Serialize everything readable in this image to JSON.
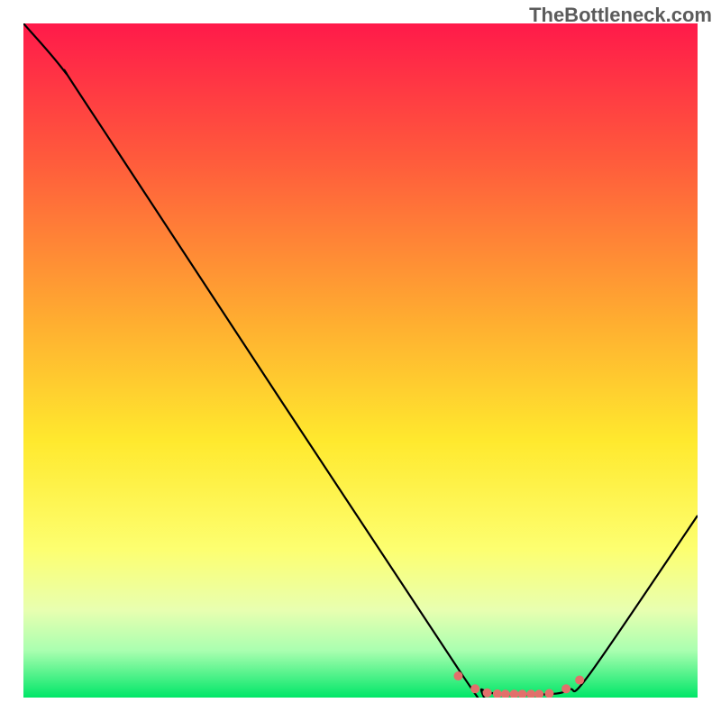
{
  "watermark": "TheBottleneck.com",
  "chart_data": {
    "type": "line",
    "title": "",
    "xlabel": "",
    "ylabel": "",
    "xlim": [
      0,
      100
    ],
    "ylim": [
      0,
      100
    ],
    "gradient_stops": [
      {
        "offset": 0,
        "color": "#ff1a4a"
      },
      {
        "offset": 20,
        "color": "#ff5a3c"
      },
      {
        "offset": 45,
        "color": "#ffb030"
      },
      {
        "offset": 62,
        "color": "#ffe92e"
      },
      {
        "offset": 78,
        "color": "#fdff70"
      },
      {
        "offset": 87,
        "color": "#e8ffb0"
      },
      {
        "offset": 93,
        "color": "#aaffb0"
      },
      {
        "offset": 100,
        "color": "#00e668"
      }
    ],
    "series": [
      {
        "name": "curve",
        "stroke": "#000000",
        "points": [
          {
            "x": 0,
            "y": 100
          },
          {
            "x": 6,
            "y": 93
          },
          {
            "x": 12,
            "y": 84
          },
          {
            "x": 65,
            "y": 3.5
          },
          {
            "x": 68,
            "y": 1.2
          },
          {
            "x": 71,
            "y": 0.5
          },
          {
            "x": 78,
            "y": 0.5
          },
          {
            "x": 81,
            "y": 1.2
          },
          {
            "x": 84,
            "y": 3.5
          },
          {
            "x": 100,
            "y": 27
          }
        ]
      }
    ],
    "markers": {
      "color": "#e2706b",
      "radius_px": 5,
      "points": [
        {
          "x": 64.5,
          "y": 3.2
        },
        {
          "x": 67.0,
          "y": 1.3
        },
        {
          "x": 68.8,
          "y": 0.7
        },
        {
          "x": 70.3,
          "y": 0.55
        },
        {
          "x": 71.5,
          "y": 0.5
        },
        {
          "x": 72.8,
          "y": 0.5
        },
        {
          "x": 74.0,
          "y": 0.5
        },
        {
          "x": 75.3,
          "y": 0.5
        },
        {
          "x": 76.5,
          "y": 0.5
        },
        {
          "x": 78.0,
          "y": 0.6
        },
        {
          "x": 80.5,
          "y": 1.3
        },
        {
          "x": 82.5,
          "y": 2.6
        }
      ]
    }
  }
}
